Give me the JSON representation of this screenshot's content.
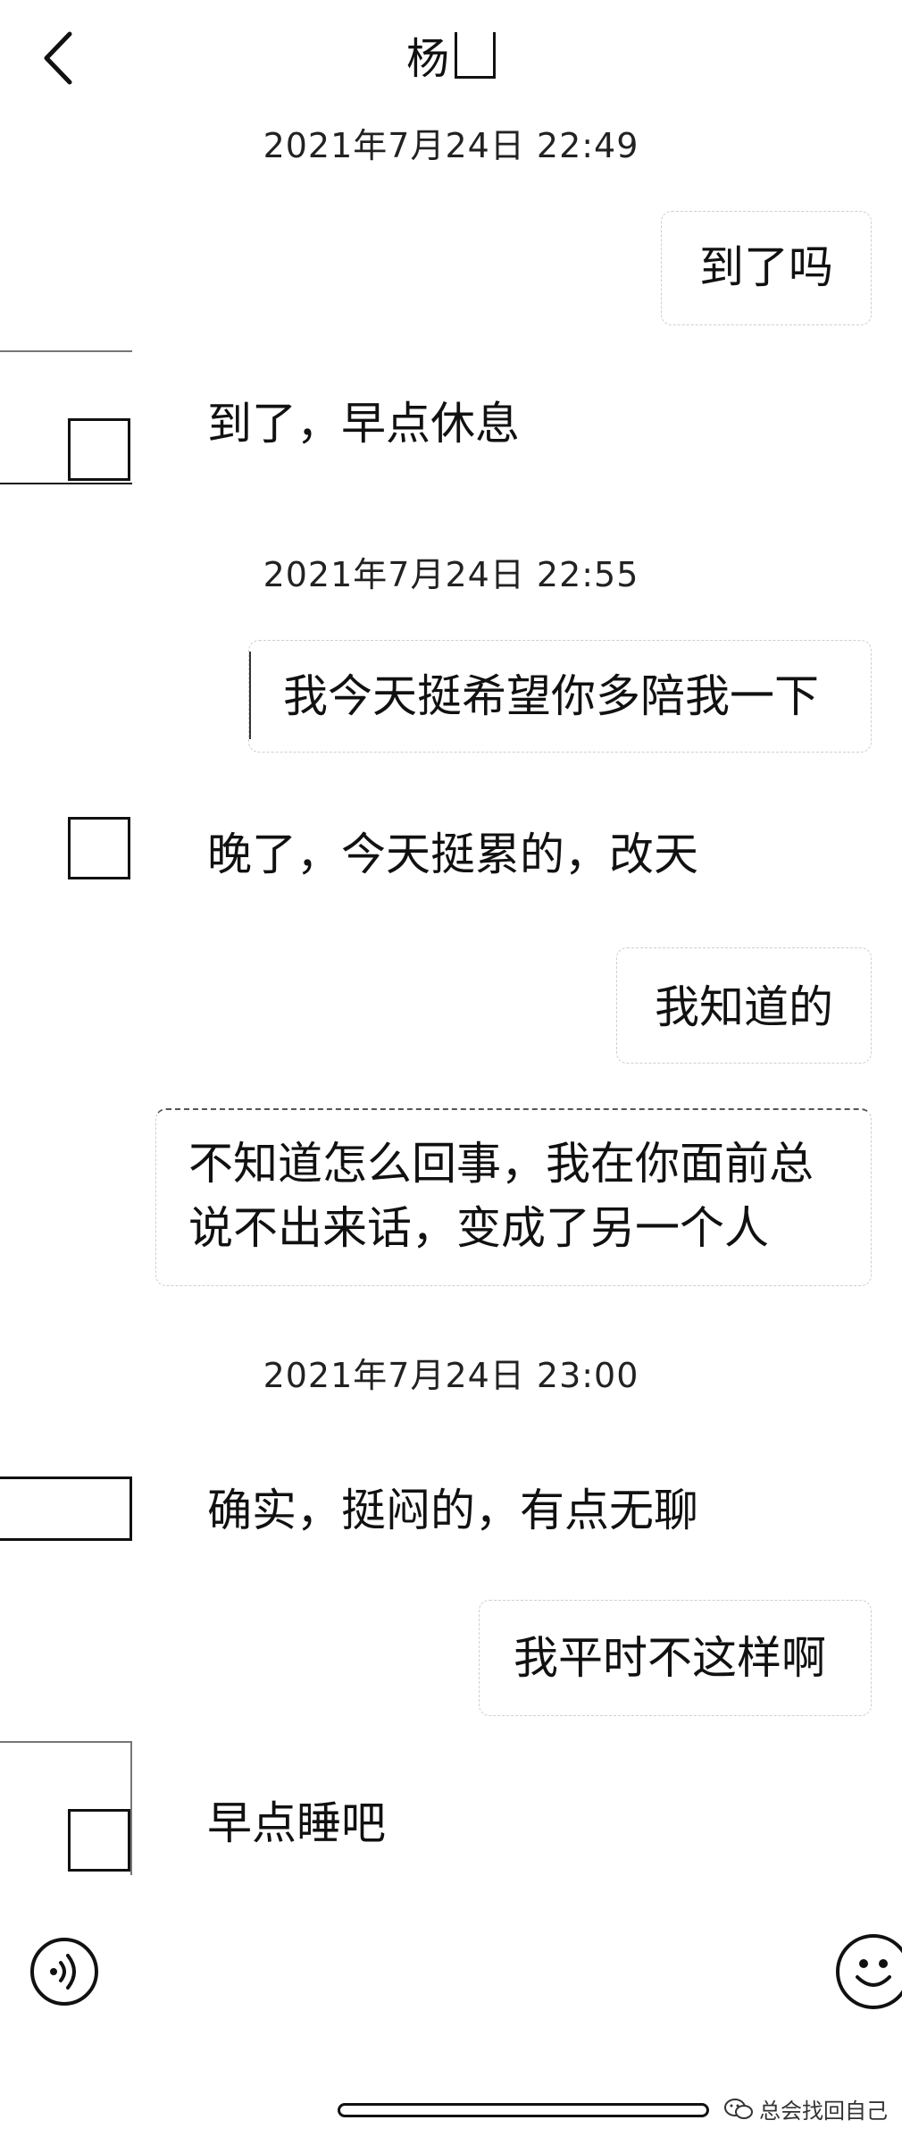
{
  "header": {
    "back_icon": "chevron-left-icon",
    "title": "杨"
  },
  "timestamps": [
    "2021年7月24日 22:49",
    "2021年7月24日 22:55",
    "2021年7月24日 23:00"
  ],
  "messages": [
    {
      "side": "right",
      "text": "到了吗"
    },
    {
      "side": "left",
      "text": "到了，早点休息"
    },
    {
      "side": "right",
      "text": "我今天挺希望你多陪我一下"
    },
    {
      "side": "left",
      "text": "晚了，今天挺累的，改天"
    },
    {
      "side": "right",
      "text": "我知道的"
    },
    {
      "side": "right",
      "text_line1": "不知道怎么回事，我在你面前总",
      "text_line2": "说不出来话，变成了另一个人"
    },
    {
      "side": "left",
      "text": "确实，挺闷的，有点无聊"
    },
    {
      "side": "right",
      "text": "我平时不这样啊"
    },
    {
      "side": "left",
      "text": "早点睡吧"
    }
  ],
  "bottom_bar": {
    "voice_icon": "voice-icon",
    "emoji_icon": "emoji-icon"
  },
  "watermark": {
    "icon": "wechat-icon",
    "text": "总会找回自己"
  }
}
